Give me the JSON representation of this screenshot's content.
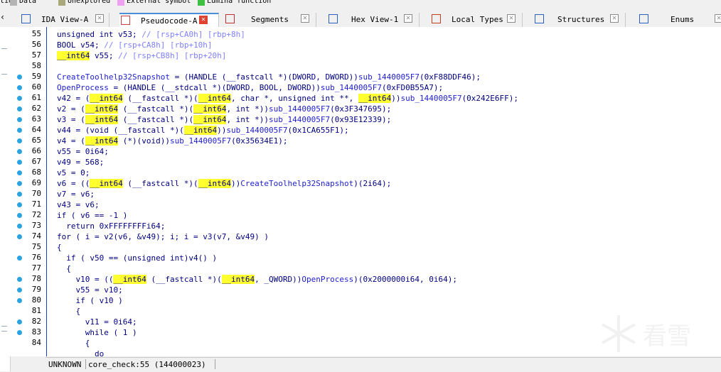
{
  "legend": [
    {
      "label": "tion",
      "color": ""
    },
    {
      "label": "Data",
      "color": "#b4b4b4"
    },
    {
      "label": "Unexplored",
      "color": "#a8a87a"
    },
    {
      "label": "External symbol",
      "color": "#f0a0f0"
    },
    {
      "label": "Lumina function",
      "color": "#40c040"
    }
  ],
  "tabs": [
    {
      "label": "IDA View-A",
      "icon": "ida-view-icon",
      "active": false
    },
    {
      "label": "Pseudocode-A",
      "icon": "pseudocode-icon",
      "active": true
    },
    {
      "label": "Segments",
      "icon": "segments-icon",
      "active": false
    },
    {
      "label": "Hex View-1",
      "icon": "hex-view-icon",
      "active": false
    },
    {
      "label": "Local Types",
      "icon": "local-types-icon",
      "active": false
    },
    {
      "label": "Structures",
      "icon": "structures-icon",
      "active": false
    },
    {
      "label": "Enums",
      "icon": "enums-icon",
      "active": false
    }
  ],
  "tab_close_symbol": "✕",
  "left_arrow": "‹",
  "code": {
    "line_numbers": [
      "55",
      "56",
      "57",
      "58",
      "59",
      "60",
      "61",
      "62",
      "63",
      "64",
      "65",
      "66",
      "67",
      "68",
      "69",
      "70",
      "71",
      "72",
      "73",
      "74",
      "75",
      "76",
      "77",
      "78",
      "79",
      "80",
      "81",
      "82",
      "83",
      "84"
    ],
    "breakpoint_lines": [
      "59",
      "60",
      "61",
      "62",
      "63",
      "64",
      "65",
      "66",
      "67",
      "68",
      "69",
      "70",
      "71",
      "72",
      "73",
      "74",
      "76",
      "78",
      "79",
      "80",
      "82",
      "83"
    ],
    "lines": [
      [
        [
          "t",
          "unsigned int v53; "
        ],
        [
          "c",
          "// [rsp+CA0h] [rbp+8h]"
        ]
      ],
      [
        [
          "t",
          "BOOL v54; "
        ],
        [
          "c",
          "// [rsp+CA8h] [rbp+10h]"
        ]
      ],
      [
        [
          "h",
          "__int64"
        ],
        [
          "t",
          " v55; "
        ],
        [
          "c",
          "// [rsp+CB8h] [rbp+20h]"
        ]
      ],
      [],
      [
        [
          "f",
          "CreateToolhelp32Snapshot"
        ],
        [
          "t",
          " = (HANDLE (__fastcall *)(DWORD, DWORD))"
        ],
        [
          "f",
          "sub_1440005F7"
        ],
        [
          "t",
          "(0xF88DDF46);"
        ]
      ],
      [
        [
          "f",
          "OpenProcess"
        ],
        [
          "t",
          " = (HANDLE (__stdcall *)(DWORD, BOOL, DWORD))"
        ],
        [
          "f",
          "sub_1440005F7"
        ],
        [
          "t",
          "(0xFD0B55A7);"
        ]
      ],
      [
        [
          "t",
          "v42 = ("
        ],
        [
          "h",
          "__int64"
        ],
        [
          "t",
          " (__fastcall *)("
        ],
        [
          "h",
          "__int64"
        ],
        [
          "t",
          ", char *, unsigned int **, "
        ],
        [
          "h",
          "__int64"
        ],
        [
          "t",
          "))"
        ],
        [
          "f",
          "sub_1440005F7"
        ],
        [
          "t",
          "(0x242E6FF);"
        ]
      ],
      [
        [
          "t",
          "v2 = ("
        ],
        [
          "h",
          "__int64"
        ],
        [
          "t",
          " (__fastcall *)("
        ],
        [
          "h",
          "__int64"
        ],
        [
          "t",
          ", int *))"
        ],
        [
          "f",
          "sub_1440005F7"
        ],
        [
          "t",
          "(0x3F347695);"
        ]
      ],
      [
        [
          "t",
          "v3 = ("
        ],
        [
          "h",
          "__int64"
        ],
        [
          "t",
          " (__fastcall *)("
        ],
        [
          "h",
          "__int64"
        ],
        [
          "t",
          ", int *))"
        ],
        [
          "f",
          "sub_1440005F7"
        ],
        [
          "t",
          "(0x93E12339);"
        ]
      ],
      [
        [
          "t",
          "v44 = (void (__fastcall *)("
        ],
        [
          "h",
          "__int64"
        ],
        [
          "t",
          "))"
        ],
        [
          "f",
          "sub_1440005F7"
        ],
        [
          "t",
          "(0x1CA655F1);"
        ]
      ],
      [
        [
          "t",
          "v4 = ("
        ],
        [
          "h",
          "__int64"
        ],
        [
          "t",
          " (*)(void))"
        ],
        [
          "f",
          "sub_1440005F7"
        ],
        [
          "t",
          "(0x35634E1);"
        ]
      ],
      [
        [
          "t",
          "v55 = 0i64;"
        ]
      ],
      [
        [
          "t",
          "v49 = 568;"
        ]
      ],
      [
        [
          "t",
          "v5 = 0;"
        ]
      ],
      [
        [
          "t",
          "v6 = (("
        ],
        [
          "h",
          "__int64"
        ],
        [
          "t",
          " (__fastcall *)("
        ],
        [
          "h",
          "__int64"
        ],
        [
          "t",
          "))"
        ],
        [
          "f",
          "CreateToolhelp32Snapshot"
        ],
        [
          "t",
          ")(2i64);"
        ]
      ],
      [
        [
          "t",
          "v7 = v6;"
        ]
      ],
      [
        [
          "t",
          "v43 = v6;"
        ]
      ],
      [
        [
          "t",
          "if ( v6 == -1 )"
        ]
      ],
      [
        [
          "t",
          "  return 0xFFFFFFFFi64;"
        ]
      ],
      [
        [
          "t",
          "for ( i = v2(v6, &v49); i; i = v3(v7, &v49) )"
        ]
      ],
      [
        [
          "t",
          "{"
        ]
      ],
      [
        [
          "t",
          "  if ( v50 == (unsigned int)v4() )"
        ]
      ],
      [
        [
          "t",
          "  {"
        ]
      ],
      [
        [
          "t",
          "    v10 = (("
        ],
        [
          "h",
          "__int64"
        ],
        [
          "t",
          " (__fastcall *)("
        ],
        [
          "h",
          "__int64"
        ],
        [
          "t",
          ", _QWORD))"
        ],
        [
          "f",
          "OpenProcess"
        ],
        [
          "t",
          ")(0x2000000i64, 0i64);"
        ]
      ],
      [
        [
          "t",
          "    v55 = v10;"
        ]
      ],
      [
        [
          "t",
          "    if ( v10 )"
        ]
      ],
      [
        [
          "t",
          "    {"
        ]
      ],
      [
        [
          "t",
          "      v11 = 0i64;"
        ]
      ],
      [
        [
          "t",
          "      while ( 1 )"
        ]
      ],
      [
        [
          "t",
          "      {"
        ]
      ],
      [
        [
          "t",
          "        do"
        ]
      ]
    ]
  },
  "status": {
    "mode": "UNKNOWN",
    "location": "core_check:55 (144000023)"
  },
  "watermark": {
    "text": "看雪"
  }
}
